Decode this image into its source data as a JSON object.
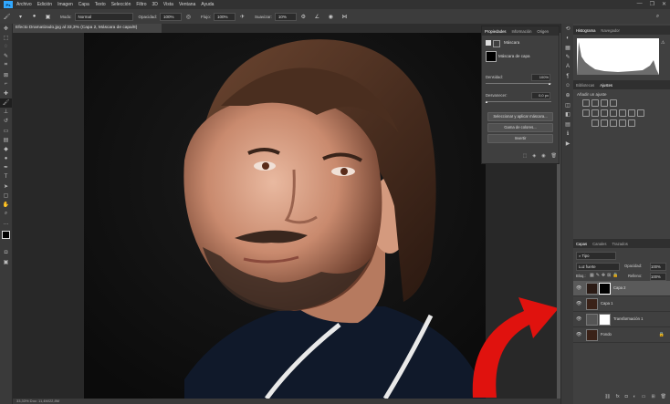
{
  "menu": {
    "logo": "Ps",
    "items": [
      "Archivo",
      "Edición",
      "Imagen",
      "Capa",
      "Texto",
      "Selección",
      "Filtro",
      "3D",
      "Vista",
      "Ventana",
      "Ayuda"
    ],
    "window_controls": [
      "—",
      "❐",
      "✕"
    ]
  },
  "options": {
    "mode_label": "Modo:",
    "mode_value": "Normal",
    "opacity_label": "Opacidad:",
    "opacity_value": "100%",
    "flow_label": "Flujo:",
    "flow_value": "100%",
    "smooth_label": "Suavizar:",
    "smooth_value": "10%"
  },
  "document": {
    "tab_title": "Efecto Dramatizado.jpg al 33,3% (Capa 2, Máscara de capa/8)",
    "status": "33,33%   Doc: 11,4M/22,8M"
  },
  "properties": {
    "tabs": [
      "Propiedades",
      "Información",
      "Origen"
    ],
    "mode_label": "Máscara",
    "title": "Máscara de capa",
    "density_label": "Densidad:",
    "density_value": "100%",
    "feather_label": "Desvanecer:",
    "feather_value": "0,0 px",
    "button_select": "Seleccionar y aplicar máscara...",
    "button_color": "Gama de colores...",
    "button_invert": "Invertir"
  },
  "histogram": {
    "tabs": [
      "Histograma",
      "Navegador"
    ]
  },
  "adjustments": {
    "tabs": [
      "Bibliotecas",
      "Ajustes"
    ],
    "title": "Añadir un ajuste"
  },
  "layers": {
    "tabs": [
      "Capas",
      "Canales",
      "Trazados"
    ],
    "filter_value": "Tipo",
    "blend_value": "Luz fuerte",
    "opacity_label": "Opacidad:",
    "opacity_value": "100%",
    "lock_label": "Bloq.:",
    "fill_label": "Relleno:",
    "fill_value": "100%",
    "items": [
      {
        "name": "Capa 2"
      },
      {
        "name": "Capa 1"
      },
      {
        "name": "Transformación 1"
      },
      {
        "name": "Fondo"
      }
    ]
  },
  "colors": {
    "accent_arrow": "#e0120e",
    "panel_bg": "#404040",
    "menubar_bg": "#323232"
  }
}
